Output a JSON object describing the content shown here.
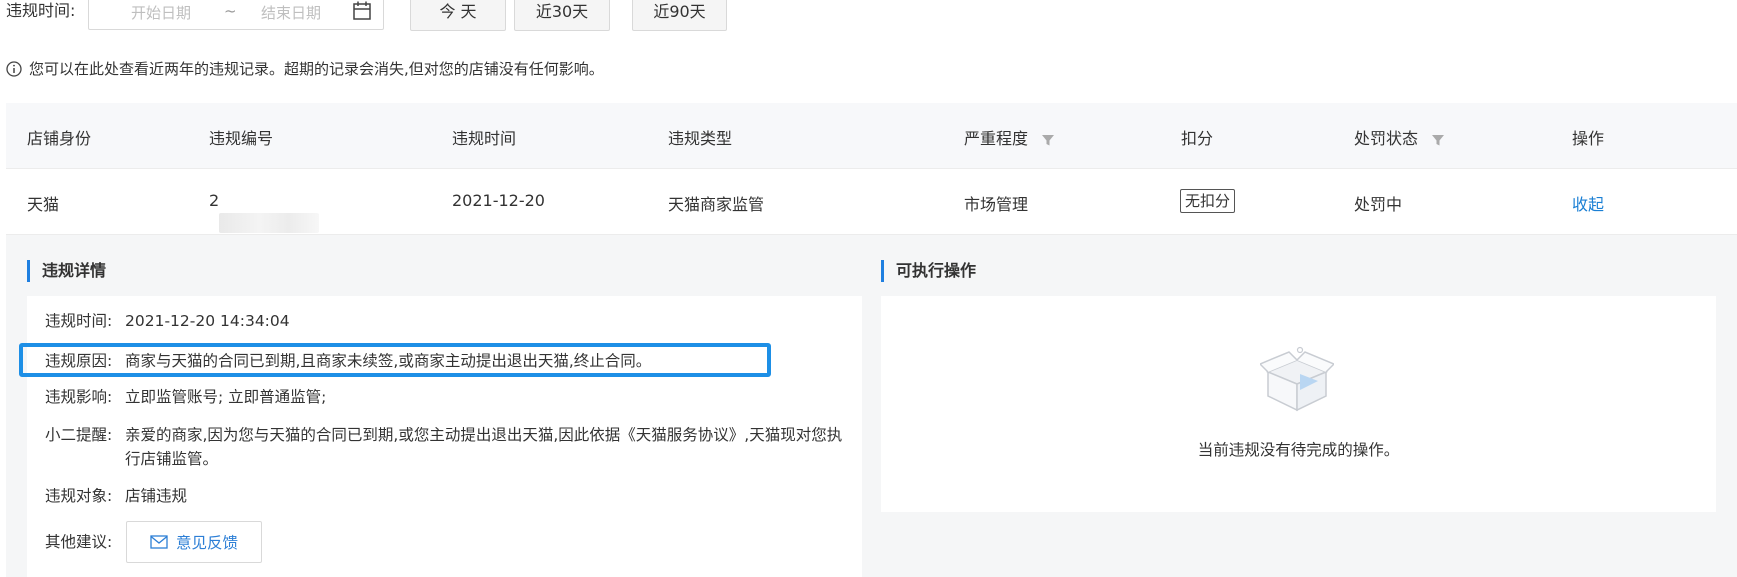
{
  "filter": {
    "label": "违规时间:",
    "date_start_placeholder": "开始日期",
    "date_separator": "~",
    "date_end_placeholder": "结束日期",
    "quick_buttons": [
      "今 天",
      "近30天",
      "近90天"
    ]
  },
  "notice": "您可以在此处查看近两年的违规记录。超期的记录会消失,但对您的店铺没有任何影响。",
  "table": {
    "headers": [
      "店铺身份",
      "违规编号",
      "违规时间",
      "违规类型",
      "严重程度",
      "扣分",
      "处罚状态",
      "操作"
    ],
    "row": {
      "shop_identity": "天猫",
      "violation_id_prefix": "2",
      "violation_time": "2021-12-20",
      "violation_type": "天猫商家监管",
      "severity": "市场管理",
      "deduction": "无扣分",
      "penalty_status": "处罚中",
      "action": "收起"
    }
  },
  "details": {
    "title": "违规详情",
    "items": [
      {
        "label": "违规时间:",
        "value": "2021-12-20 14:34:04"
      },
      {
        "label": "违规原因:",
        "value": "商家与天猫的合同已到期,且商家未续签,或商家主动提出退出天猫,终止合同。"
      },
      {
        "label": "违规影响:",
        "value": "立即监管账号; 立即普通监管;"
      },
      {
        "label": "小二提醒:",
        "value": "亲爱的商家,因为您与天猫的合同已到期,或您主动提出退出天猫,因此依据《天猫服务协议》,天猫现对您执行店铺监管。"
      },
      {
        "label": "违规对象:",
        "value": "店铺违规"
      },
      {
        "label": "其他建议:",
        "value": ""
      }
    ],
    "feedback_button": "意见反馈"
  },
  "actions": {
    "title": "可执行操作",
    "empty_text": "当前违规没有待完成的操作。"
  },
  "colors": {
    "accent": "#1f7fe0",
    "highlight_border": "#1d8fe6",
    "link": "#1a7fd4"
  }
}
